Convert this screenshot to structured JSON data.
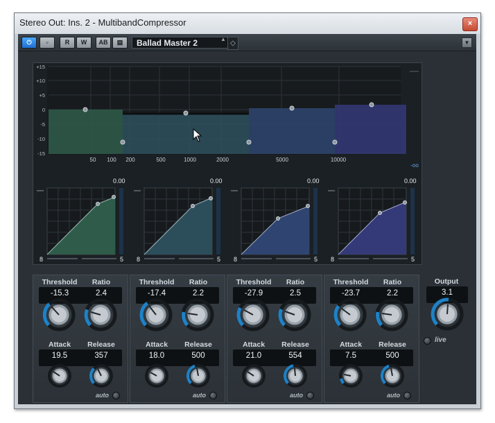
{
  "window": {
    "title": "Stereo Out: Ins. 2 - MultibandCompressor",
    "close_label": "×"
  },
  "toolbar": {
    "power_label": "⏻",
    "bypass_label": "▫",
    "read_label": "R",
    "write_label": "W",
    "ab_label": "AB",
    "compare_label": "▤",
    "preset_name": "Ballad Master 2",
    "preset_arrows": "▲▼",
    "preset_save_label": "◇",
    "menu_label": "▼"
  },
  "graph": {
    "db_ticks": [
      "+15",
      "+10",
      "+5",
      "0",
      "-5",
      "-10",
      "-15"
    ],
    "freq_ticks": [
      "50",
      "100",
      "200",
      "500",
      "1000",
      "2000",
      "5000",
      "10000"
    ],
    "minus_inf": "-oo"
  },
  "curves": {
    "values": [
      "0.00",
      "0.00",
      "0.00",
      "0.00"
    ],
    "axis_low": "8",
    "axis_high": "5"
  },
  "labels": {
    "threshold": "Threshold",
    "ratio": "Ratio",
    "attack": "Attack",
    "release": "Release",
    "auto": "auto",
    "output": "Output",
    "live": "live"
  },
  "bands": [
    {
      "threshold": "-15.3",
      "ratio": "2.4",
      "attack": "19.5",
      "release": "357"
    },
    {
      "threshold": "-17.4",
      "ratio": "2.2",
      "attack": "18.0",
      "release": "500"
    },
    {
      "threshold": "-27.9",
      "ratio": "2.5",
      "attack": "21.0",
      "release": "554"
    },
    {
      "threshold": "-23.7",
      "ratio": "2.2",
      "attack": "7.5",
      "release": "500"
    }
  ],
  "output": {
    "value": "3.1"
  },
  "colors": {
    "band1": "#2f5c4a",
    "band2": "#2c4e5a",
    "band3": "#2f4470",
    "band4": "#343a78",
    "knob_ring": "#1d82c8",
    "background": "#2a3036"
  }
}
